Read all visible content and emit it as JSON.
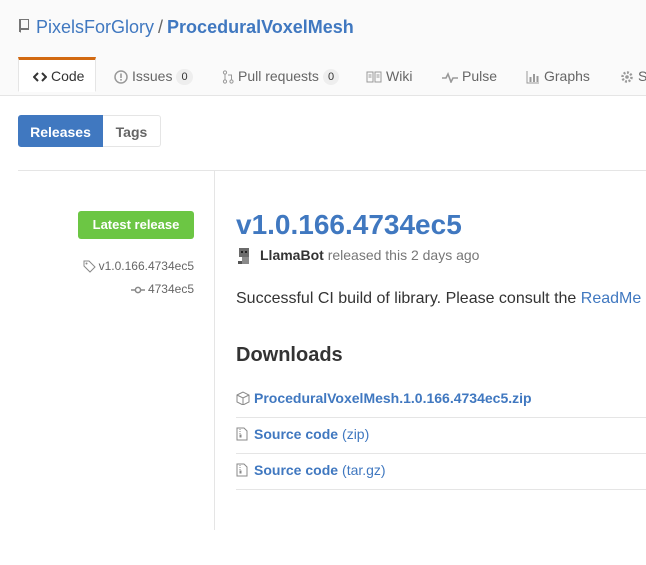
{
  "repo": {
    "owner": "PixelsForGlory",
    "separator": "/",
    "name": "ProceduralVoxelMesh"
  },
  "tabs": [
    {
      "label": "Code",
      "icon": "code-icon",
      "selected": true
    },
    {
      "label": "Issues",
      "icon": "issue-icon",
      "count": "0"
    },
    {
      "label": "Pull requests",
      "icon": "pull-request-icon",
      "count": "0"
    },
    {
      "label": "Wiki",
      "icon": "book-icon"
    },
    {
      "label": "Pulse",
      "icon": "pulse-icon"
    },
    {
      "label": "Graphs",
      "icon": "graph-icon"
    },
    {
      "label": "S",
      "icon": "gear-icon"
    }
  ],
  "subnav": {
    "releases": "Releases",
    "tags": "Tags"
  },
  "sidebar": {
    "badge": "Latest release",
    "tag": "v1.0.166.4734ec5",
    "commit": "4734ec5"
  },
  "release": {
    "title": "v1.0.166.4734ec5",
    "author": "LlamaBot",
    "released_text": "released this 2 days ago",
    "description": "Successful CI build of library. Please consult the ",
    "description_link": "ReadMe",
    "downloads_heading": "Downloads",
    "downloads": [
      {
        "name": "ProceduralVoxelMesh.1.0.166.4734ec5.zip",
        "sub": "",
        "icon": "package-icon"
      },
      {
        "name": "Source code",
        "sub": "(zip)",
        "icon": "file-zip-icon"
      },
      {
        "name": "Source code",
        "sub": "(tar.gz)",
        "icon": "file-zip-icon"
      }
    ]
  },
  "colors": {
    "link": "#4078c0",
    "badge": "#6cc644",
    "tab_accent": "#d26911"
  }
}
